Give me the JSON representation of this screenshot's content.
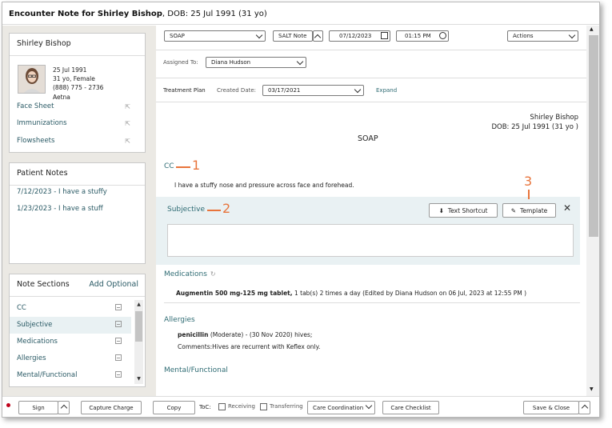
{
  "window": {
    "title_bold": "Encounter Note for Shirley Bishop",
    "title_rest": ", DOB: 25 Jul 1991 (31 yo)"
  },
  "patient": {
    "name": "Shirley Bishop",
    "dob": "25 Jul 1991",
    "age_sex": "31 yo, Female",
    "phone": "(888) 775 - 2736",
    "insurance": "Aetna",
    "links": [
      "Face Sheet",
      "Immunizations",
      "Flowsheets"
    ]
  },
  "patient_notes": {
    "title": "Patient Notes",
    "items": [
      "7/12/2023 - I have a stuffy",
      "1/23/2023 - I have a stuff"
    ]
  },
  "note_sections": {
    "title": "Note Sections",
    "add": "Add Optional",
    "items": [
      "CC",
      "Subjective",
      "Medications",
      "Allergies",
      "Mental/Functional"
    ]
  },
  "toolbar": {
    "note_type": "SOAP",
    "salt": "SALT Note",
    "date": "07/12/2023",
    "time": "01:15 PM",
    "actions": "Actions",
    "assigned_label": "Assigned To:",
    "assigned_value": "Diana Hudson",
    "treatment_plan": "Treatment Plan",
    "created_label": "Created Date:",
    "created_value": "03/17/2021",
    "expand": "Expand"
  },
  "note": {
    "patient_name": "Shirley Bishop",
    "dob_line": "DOB: 25 Jul 1991 (31 yo )",
    "heading": "SOAP",
    "cc_label": "CC",
    "cc_text": "I have a stuffy nose and pressure across face and forehead.",
    "subjective_label": "Subjective",
    "text_shortcut": "Text Shortcut",
    "template": "Template",
    "medications_label": "Medications",
    "med_name": "Augmentin 500 mg-125 mg tablet,",
    "med_detail": " 1 tab(s) 2 times a day (Edited by Diana Hudson on 06 Jul, 2023 at 12:55 PM )",
    "allergies_label": "Allergies",
    "allergy_name": "penicillin",
    "allergy_detail": " (Moderate) - (30 Nov 2020) hives;",
    "allergy_comments": "Comments:Hives are recurrent with Keflex only.",
    "mental_label": "Mental/Functional"
  },
  "callouts": [
    "1",
    "2",
    "3"
  ],
  "footer": {
    "sign": "Sign",
    "capture_charge": "Capture Charge",
    "copy": "Copy",
    "toc": "ToC:",
    "receiving": "Receiving",
    "transferring": "Transferring",
    "care_coordination": "Care Coordination",
    "care_checklist": "Care Checklist",
    "save_close": "Save & Close"
  },
  "colors": {
    "accent": "#2e6b73",
    "callout": "#e8743b",
    "status_dot": "#c0001a"
  }
}
